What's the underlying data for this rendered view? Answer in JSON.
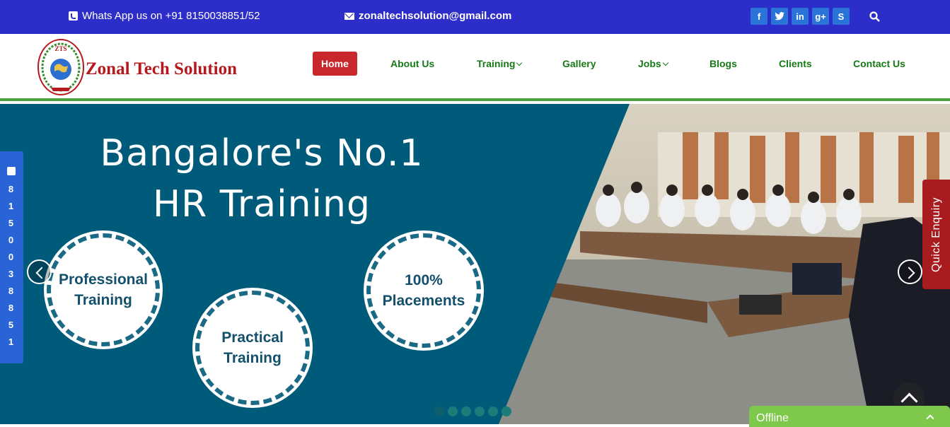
{
  "topbar": {
    "whatsapp": "Whats App us on +91 8150038851/52",
    "email": "zonaltechsolution@gmail.com",
    "social": [
      "f",
      "t",
      "in",
      "g+",
      "S"
    ],
    "colors": {
      "bar": "#2d2ec9",
      "social": "#2a73d9"
    }
  },
  "header": {
    "logo_text": "ZTS",
    "brand": "Zonal Tech Solution",
    "nav": [
      "Home",
      "About Us",
      "Training",
      "Gallery",
      "Jobs",
      "Blogs",
      "Clients",
      "Contact Us"
    ],
    "active": "Home",
    "colors": {
      "brand": "#b5191e",
      "nav": "#167a16",
      "active_bg": "#c7272d",
      "rule": "#4aa53c"
    }
  },
  "slider": {
    "headline_1": "Bangalore's No.1",
    "headline_2": "HR Training",
    "badges": [
      "Professional\nTraining",
      "Practical\nTraining",
      "100%\nPlacements"
    ],
    "dots": 6,
    "active_dot": 1,
    "colors": {
      "panel": "#005b7a"
    }
  },
  "sidebar": {
    "phone_digits": [
      "8",
      "1",
      "5",
      "0",
      "0",
      "3",
      "8",
      "8",
      "5",
      "1"
    ]
  },
  "enquiry": {
    "label": "Quick Enquiry"
  },
  "chat": {
    "status": "Offline"
  }
}
